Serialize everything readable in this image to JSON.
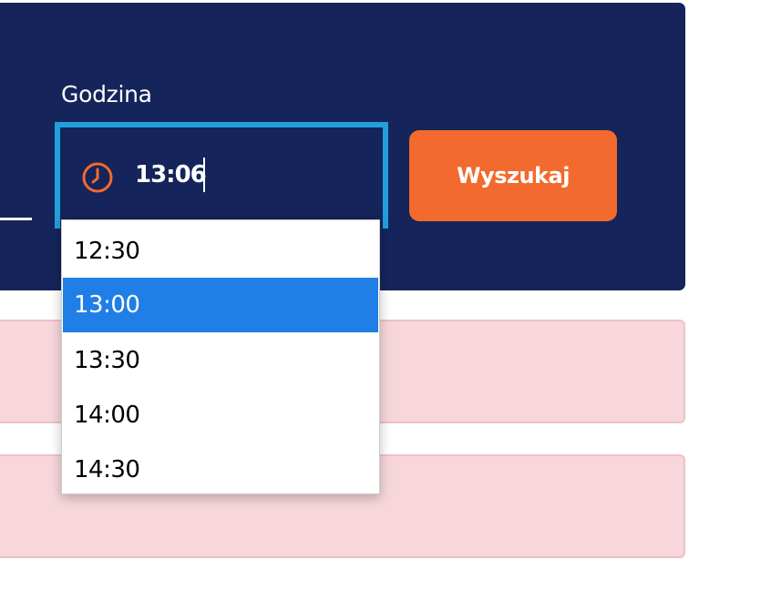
{
  "form": {
    "time_label": "Godzina",
    "time_value": "13:06",
    "search_button_label": "Wyszukaj"
  },
  "time_dropdown": {
    "options": [
      "12:30",
      "13:00",
      "13:30",
      "14:00",
      "14:30"
    ],
    "highlighted_option": "13:00"
  },
  "colors": {
    "panel_background": "#15245a",
    "input_focus_border": "#21a0dc",
    "accent_orange": "#f26a2e",
    "highlight_blue": "#1f7fe6",
    "alert_background": "#f7d7db",
    "alert_border": "#efc1c7"
  },
  "icons": {
    "time_input_icon": "clock-icon"
  }
}
